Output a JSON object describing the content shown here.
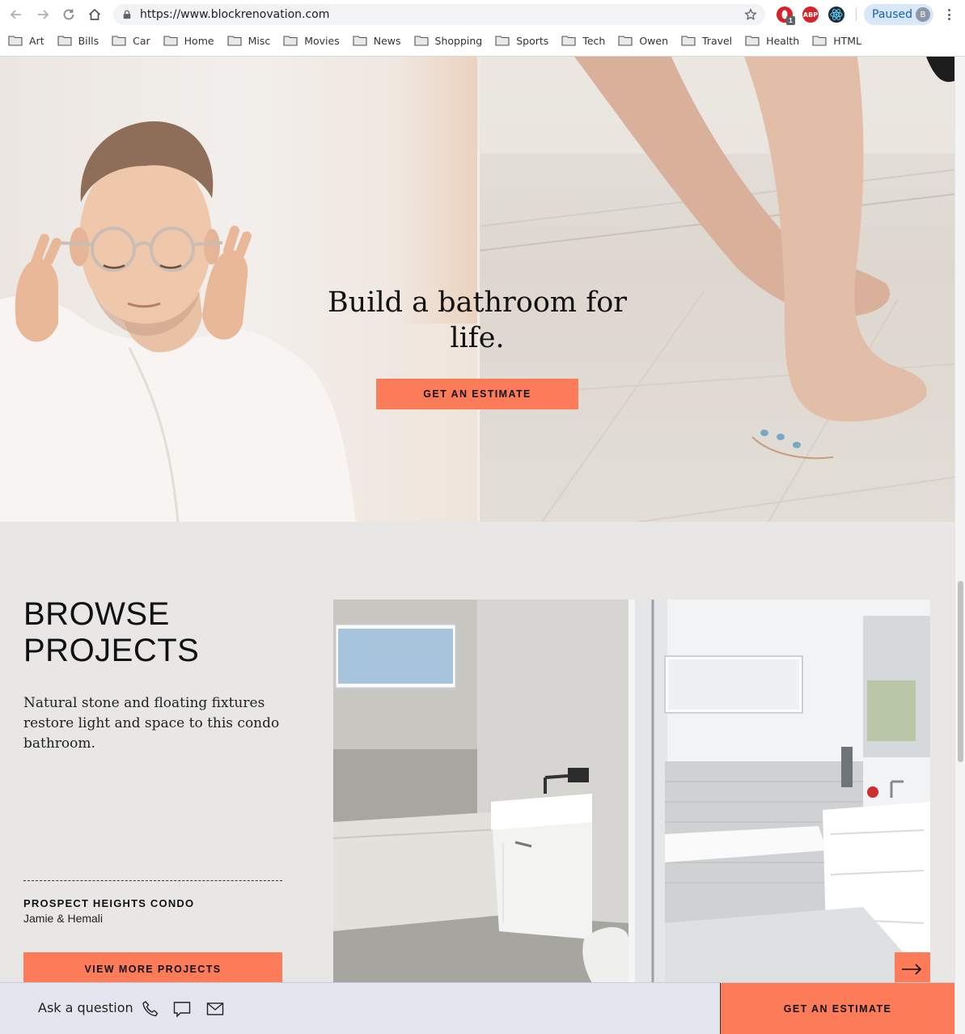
{
  "browser": {
    "url": "https://www.blockrenovation.com",
    "profile_label": "Paused",
    "profile_initial": "B",
    "ext_badge": "1",
    "ext_abp": "ABP",
    "bookmarks": [
      "Art",
      "Bills",
      "Car",
      "Home",
      "Misc",
      "Movies",
      "News",
      "Shopping",
      "Sports",
      "Tech",
      "Owen",
      "Travel",
      "Health",
      "HTML"
    ]
  },
  "hero": {
    "title": "Build a bathroom for life.",
    "cta": "GET AN ESTIMATE"
  },
  "projects": {
    "title": "BROWSE PROJECTS",
    "description": "Natural stone and floating fixtures restore light and space to this condo bathroom.",
    "project_name": "PROSPECT HEIGHTS CONDO",
    "client": "Jamie & Hemali",
    "cta": "VIEW MORE PROJECTS"
  },
  "footer_bar": {
    "ask_label": "Ask a question",
    "cta": "GET AN ESTIMATE"
  },
  "colors": {
    "accent": "#fc7c5a",
    "page_bg": "#e8e7e6",
    "bar_bg": "#e3e6ee"
  },
  "icons": [
    "back-icon",
    "forward-icon",
    "reload-icon",
    "home-icon",
    "lock-icon",
    "star-icon",
    "phone-icon",
    "chat-icon",
    "mail-icon",
    "arrow-right-icon",
    "folder-icon"
  ]
}
